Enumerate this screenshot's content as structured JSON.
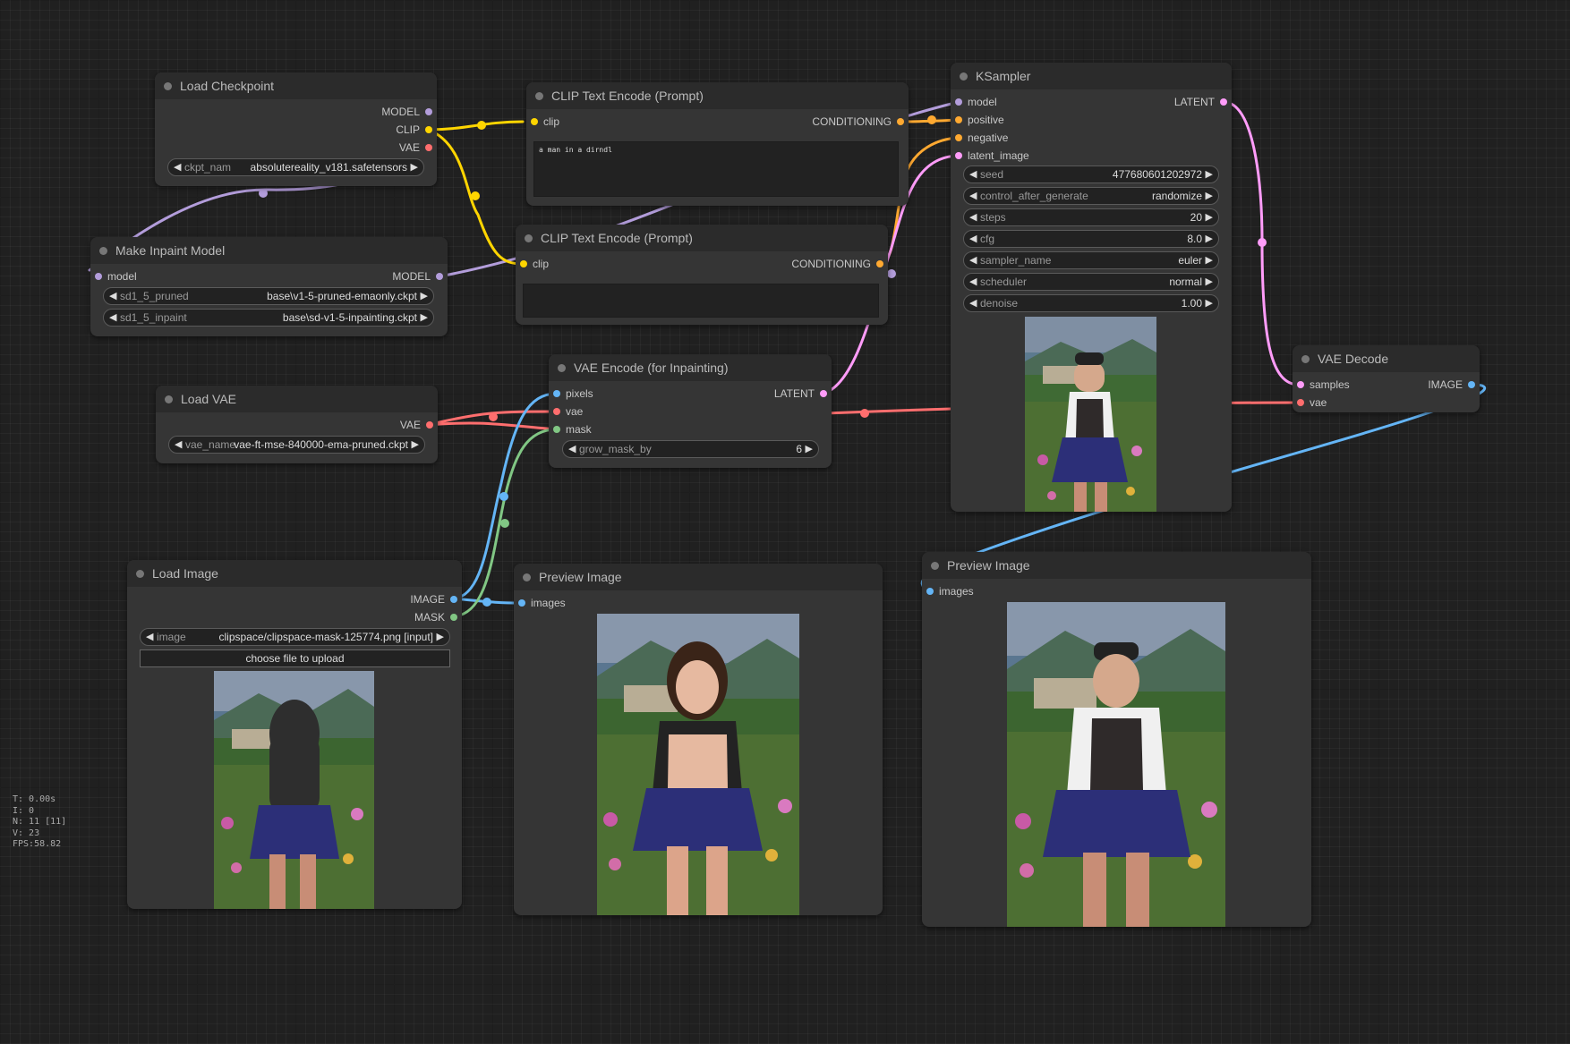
{
  "colors": {
    "model": "#b39ddb",
    "clip": "#ffd500",
    "vae": "#ff6e6e",
    "conditioning": "#ffa931",
    "latent": "#ff9cf9",
    "image": "#64b5f6",
    "mask": "#81c784",
    "canvas": "#202020",
    "node": "#353535"
  },
  "nodes": {
    "load_checkpoint": {
      "title": "Load Checkpoint",
      "outputs": [
        "MODEL",
        "CLIP",
        "VAE"
      ],
      "ckpt_name_label": "ckpt_nam",
      "ckpt_name_value": "absolutereality_v181.safetensors"
    },
    "make_inpaint_model": {
      "title": "Make Inpaint Model",
      "input": "model",
      "output": "MODEL",
      "widgets": [
        {
          "label": "sd1_5_pruned",
          "value": "base\\v1-5-pruned-emaonly.ckpt"
        },
        {
          "label": "sd1_5_inpaint",
          "value": "base\\sd-v1-5-inpainting.ckpt"
        }
      ]
    },
    "load_vae": {
      "title": "Load VAE",
      "output": "VAE",
      "vae_name_label": "vae_name",
      "vae_name_value": "vae-ft-mse-840000-ema-pruned.ckpt"
    },
    "clip_text_encode_1": {
      "title": "CLIP Text Encode (Prompt)",
      "input": "clip",
      "output": "CONDITIONING",
      "text": "a man in a dirndl"
    },
    "clip_text_encode_2": {
      "title": "CLIP Text Encode (Prompt)",
      "input": "clip",
      "output": "CONDITIONING",
      "text": ""
    },
    "vae_encode_inpaint": {
      "title": "VAE Encode (for Inpainting)",
      "inputs": [
        "pixels",
        "vae",
        "mask"
      ],
      "output": "LATENT",
      "grow_mask_by_label": "grow_mask_by",
      "grow_mask_by_value": "6"
    },
    "ksampler": {
      "title": "KSampler",
      "inputs": [
        "model",
        "positive",
        "negative",
        "latent_image"
      ],
      "output": "LATENT",
      "widgets": [
        {
          "label": "seed",
          "value": "477680601202972"
        },
        {
          "label": "control_after_generate",
          "value": "randomize"
        },
        {
          "label": "steps",
          "value": "20"
        },
        {
          "label": "cfg",
          "value": "8.0"
        },
        {
          "label": "sampler_name",
          "value": "euler"
        },
        {
          "label": "scheduler",
          "value": "normal"
        },
        {
          "label": "denoise",
          "value": "1.00"
        }
      ]
    },
    "vae_decode": {
      "title": "VAE Decode",
      "inputs": [
        "samples",
        "vae"
      ],
      "output": "IMAGE"
    },
    "load_image": {
      "title": "Load Image",
      "outputs": [
        "IMAGE",
        "MASK"
      ],
      "image_label": "image",
      "image_value": "clipspace/clipspace-mask-125774.png [input]",
      "upload_button": "choose file to upload"
    },
    "preview_image_1": {
      "title": "Preview Image",
      "input": "images"
    },
    "preview_image_2": {
      "title": "Preview Image",
      "input": "images"
    }
  },
  "stats": {
    "t": "T: 0.00s",
    "i": "I: 0",
    "n": "N: 11 [11]",
    "v": "V: 23",
    "fps": "FPS:58.82"
  }
}
